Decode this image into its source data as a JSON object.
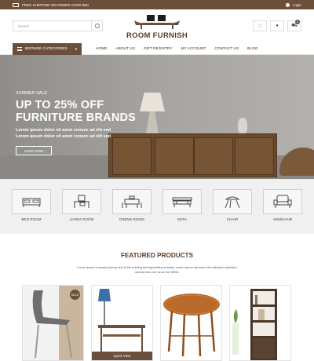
{
  "topbar": {
    "shipping": "FREE SHIPPING ON ORDER OVER $40",
    "login": "Login"
  },
  "search": {
    "placeholder": "Search"
  },
  "logo": {
    "name": "ROOM FURNISH"
  },
  "header_icons": {
    "cart_count": "0"
  },
  "nav": {
    "categories_label": "BROWSE CATEGORIES",
    "items": [
      "HOME",
      "ABOUT US",
      "GIFT REGISTRY",
      "MY ACCOUNT",
      "CONTACT US",
      "BLOG"
    ]
  },
  "hero": {
    "kicker": "SUMMER SALE",
    "title_line1": "UP TO 25% OFF",
    "title_line2": "FURNITURE BRANDS",
    "sub_line1": "Lorem ipsum dolor sit amet consec ad elit sed",
    "sub_line2": "Lorem ipsum dolor sit amet consec ad elit sed",
    "cta": "SHOP NOW"
  },
  "categories": [
    {
      "label": "BED ROOM",
      "icon": "bed-icon"
    },
    {
      "label": "LIVING ROOM",
      "icon": "desk-chair-icon"
    },
    {
      "label": "DINING ROOM",
      "icon": "dining-table-icon"
    },
    {
      "label": "SOFA",
      "icon": "sofa-icon"
    },
    {
      "label": "CHAIR",
      "icon": "chair-icon"
    },
    {
      "label": "ARMCHAIR",
      "icon": "armchair-icon"
    }
  ],
  "featured": {
    "title": "FEATURED PRODUCTS",
    "description": "Lorem Ipsum is simply dummy text of the printing and typesetting industry. Lorem Ipsum has been the industry's standard dummy text ever since the 1500s.",
    "sale_badge": "SALE",
    "quick_view": "Quick View"
  },
  "colors": {
    "brand": "#6b4f3a",
    "heading": "#5a3c28"
  }
}
